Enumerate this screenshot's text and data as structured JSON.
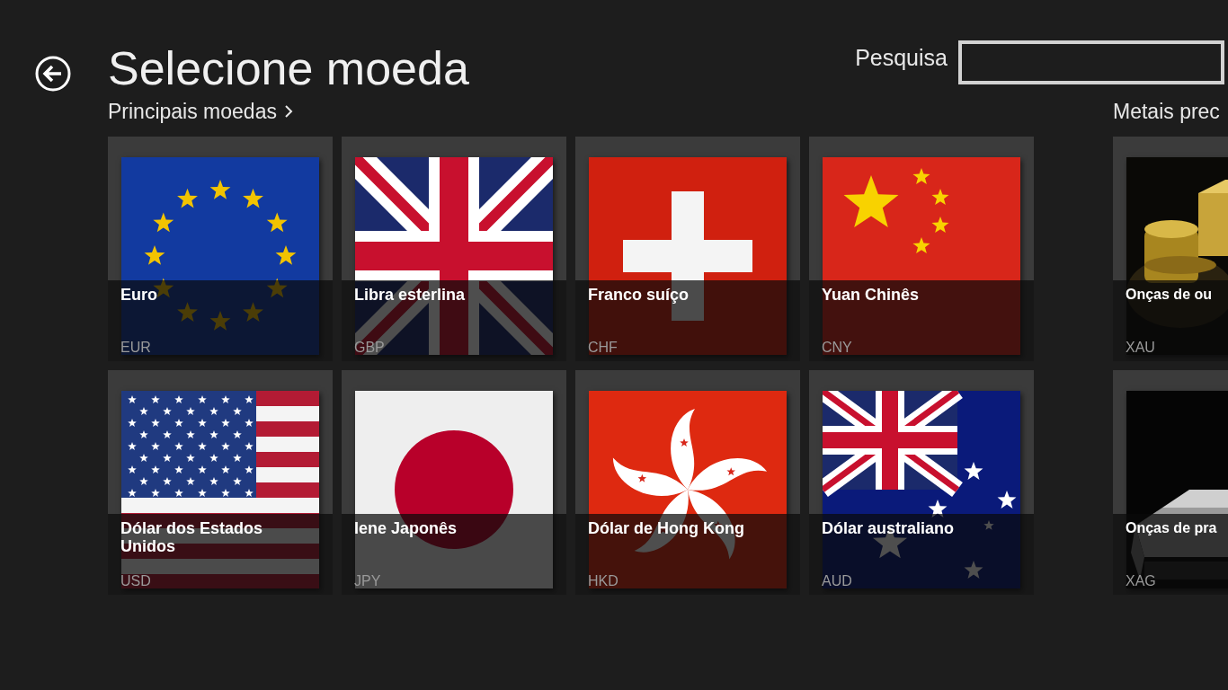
{
  "title": "Selecione moeda",
  "search": {
    "label": "Pesquisa"
  },
  "sections": [
    {
      "heading": "Principais moedas",
      "has_chevron": true,
      "cut": false,
      "tiles": [
        {
          "name": "Euro",
          "code": "EUR",
          "kind": "eu"
        },
        {
          "name": "Libra esterlina",
          "code": "GBP",
          "kind": "gb"
        },
        {
          "name": "Franco suíço",
          "code": "CHF",
          "kind": "ch"
        },
        {
          "name": "Yuan Chinês",
          "code": "CNY",
          "kind": "cn"
        },
        {
          "name": "Dólar dos Estados Unidos",
          "code": "USD",
          "kind": "us"
        },
        {
          "name": "Iene Japonês",
          "code": "JPY",
          "kind": "jp"
        },
        {
          "name": "Dólar de Hong Kong",
          "code": "HKD",
          "kind": "hk"
        },
        {
          "name": "Dólar australiano",
          "code": "AUD",
          "kind": "au"
        }
      ]
    },
    {
      "heading": "Metais prec",
      "has_chevron": false,
      "cut": true,
      "tiles": [
        {
          "name": "Onças de ou",
          "code": "XAU",
          "kind": "gold"
        },
        {
          "name": "Onças de pra",
          "code": "XAG",
          "kind": "silver"
        }
      ]
    }
  ]
}
